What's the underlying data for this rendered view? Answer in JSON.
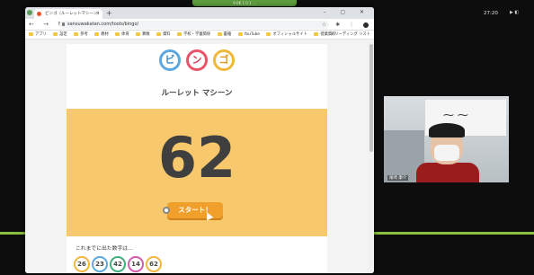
{
  "top_notice": "9.0K 1.0.1 ...",
  "browser": {
    "tab_title": "ビンゴ（ルーレットマシーン）",
    "new_tab": "+",
    "window_controls": "– ▢ ✕",
    "nav_buttons": "← → ↻ ⌂",
    "url": "sansuwakatan.com/tools/bingo/",
    "toolbar_icons": "☆ ✱ ⋮",
    "bookmarks": [
      "アプリ",
      "設定",
      "参考",
      "教材",
      "体育",
      "算数",
      "資料",
      "学校・学童関係",
      "書籍",
      "YouTube",
      "オフィシャルサイト",
      "授業資料"
    ],
    "bookmarks_more": "»  リーディング リスト"
  },
  "page": {
    "logo_letters": [
      "ビ",
      "ン",
      "ゴ"
    ],
    "subtitle": "ルーレット マシーン",
    "current_number": "62",
    "start_button": "スタート！",
    "history_label": "これまでに出た数字は…",
    "history": [
      {
        "value": "26",
        "color": "#f0b73a"
      },
      {
        "value": "23",
        "color": "#5aa8e0"
      },
      {
        "value": "42",
        "color": "#3fb07a"
      },
      {
        "value": "14",
        "color": "#d45ab0"
      },
      {
        "value": "62",
        "color": "#f0b73a"
      }
    ]
  },
  "meeting": {
    "time": "27:20",
    "side_icons": "▶ ◧",
    "participant_name": "尾崎 康介"
  },
  "colors": {
    "panel": "#f7c86c",
    "button": "#f0a02a",
    "accent_green": "#8bbf3d"
  }
}
